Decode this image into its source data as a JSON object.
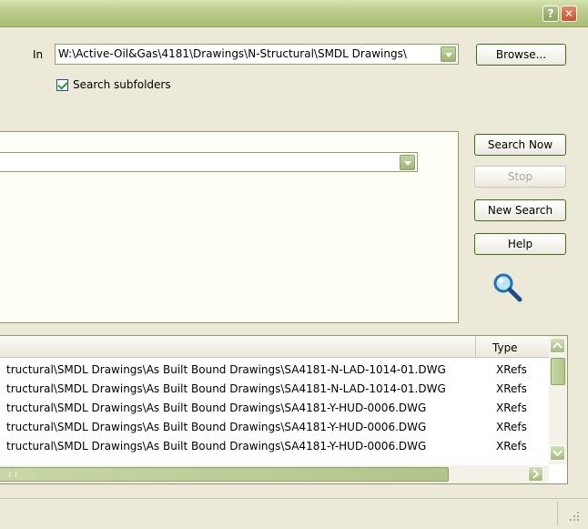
{
  "title_bar": {
    "help_label": "?",
    "close_label": "✕"
  },
  "location": {
    "in_label": "In",
    "path": "W:\\Active-Oil&Gas\\4181\\Drawings\\N-Structural\\SMDL Drawings\\",
    "browse_label": "Browse..."
  },
  "search_subfolders": {
    "label": "Search subfolders",
    "checked": true
  },
  "buttons": {
    "search_now": "Search Now",
    "stop": "Stop",
    "new_search": "New Search",
    "help": "Help"
  },
  "results": {
    "columns": [
      "Type"
    ],
    "rows": [
      {
        "path": "tructural\\SMDL Drawings\\As Built Bound Drawings\\SA4181-N-LAD-1014-01.DWG",
        "type": "XRefs"
      },
      {
        "path": "tructural\\SMDL Drawings\\As Built Bound Drawings\\SA4181-N-LAD-1014-01.DWG",
        "type": "XRefs"
      },
      {
        "path": "tructural\\SMDL Drawings\\As Built Bound Drawings\\SA4181-Y-HUD-0006.DWG",
        "type": "XRefs"
      },
      {
        "path": "tructural\\SMDL Drawings\\As Built Bound Drawings\\SA4181-Y-HUD-0006.DWG",
        "type": "XRefs"
      },
      {
        "path": "tructural\\SMDL Drawings\\As Built Bound Drawings\\SA4181-Y-HUD-0006.DWG",
        "type": "XRefs"
      }
    ]
  },
  "colors": {
    "accent": "#3f6c1a",
    "titlebar": "#bccd8c"
  }
}
